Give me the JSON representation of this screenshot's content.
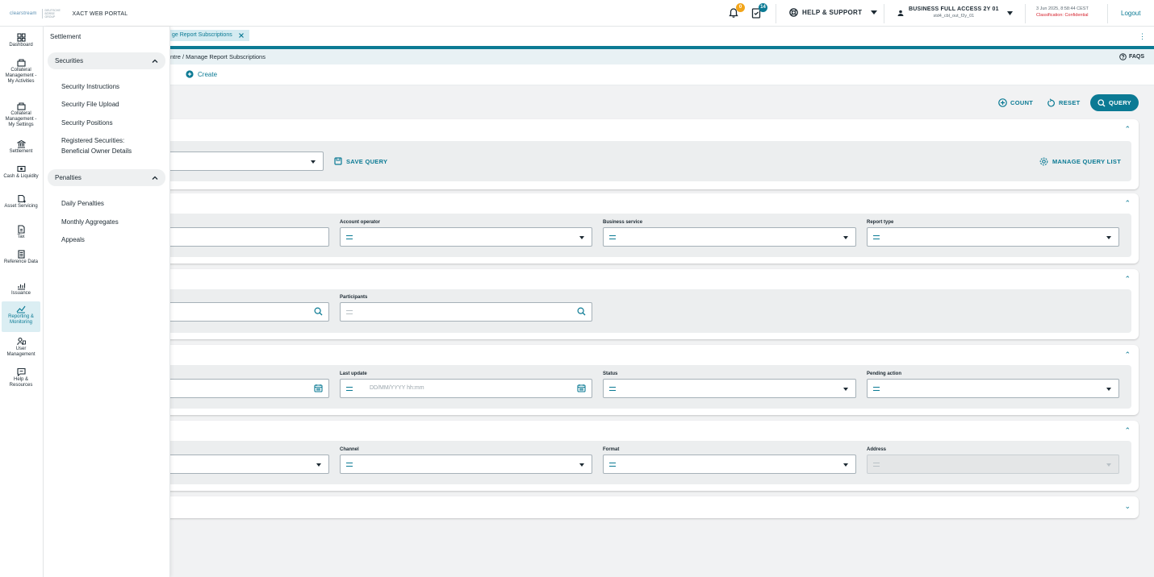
{
  "topbar": {
    "brand_logo": "clearstream",
    "brand_sub": "DEUTSCHE BÖRSE GROUP",
    "portal_name": "XACT WEB PORTAL",
    "notifications_count": "0",
    "tasks_count": "14",
    "help_label": "HELP & SUPPORT",
    "user_name": "BUSINESS FULL ACCESS 2Y 01",
    "user_id": "std4_cbl_out_f2y_01",
    "date": "3 Jun 2025, 8:58:44 CEST",
    "classification": "Classification: Confidential",
    "logout_label": "Logout"
  },
  "iconnav": {
    "items": [
      {
        "label": "Dashboard",
        "icon": "dashboard-icon"
      },
      {
        "label": "Collateral Management - My Activities",
        "icon": "collateral-icon"
      },
      {
        "label": "Collateral Management - My Settings",
        "icon": "collateral-settings-icon"
      },
      {
        "label": "Settlement",
        "icon": "bank-icon"
      },
      {
        "label": "Cash & Liquidity",
        "icon": "cash-icon"
      },
      {
        "label": "Asset Servicing",
        "icon": "asset-icon"
      },
      {
        "label": "Tax",
        "icon": "tax-icon"
      },
      {
        "label": "Reference Data",
        "icon": "reference-icon"
      },
      {
        "label": "Issuance",
        "icon": "issuance-icon"
      },
      {
        "label": "Reporting & Monitoring",
        "icon": "reporting-icon"
      },
      {
        "label": "User Management",
        "icon": "user-management-icon"
      },
      {
        "label": "Help & Resources",
        "icon": "help-icon"
      }
    ]
  },
  "flyout": {
    "title": "Settlement",
    "groups": [
      {
        "label": "Securities",
        "items": [
          "Security Instructions",
          "Security File Upload",
          "Security Positions",
          "Registered Securities: Beneficial Owner Details"
        ]
      },
      {
        "label": "Penalties",
        "items": [
          "Daily Penalties",
          "Monthly Aggregates",
          "Appeals"
        ]
      }
    ]
  },
  "tab": {
    "label": "ge Report Subscriptions"
  },
  "breadcrumb": "ntre  /  Manage Report Subscriptions",
  "faqs_label": "FAQS",
  "create_label": "Create",
  "actions": {
    "count": "COUNT",
    "reset": "RESET",
    "query": "QUERY"
  },
  "query_card": {
    "save_query": "SAVE QUERY",
    "manage_query_list": "MANAGE QUERY LIST"
  },
  "section2": {
    "labels": [
      "Account operator",
      "Business service",
      "Report type"
    ]
  },
  "section3": {
    "labels": [
      "Participants"
    ]
  },
  "section4": {
    "labels": [
      "Last update",
      "Status",
      "Pending action"
    ],
    "date_placeholder": "DD/MM/YYYY hh:mm"
  },
  "section5": {
    "labels": [
      "Channel",
      "Format",
      "Address"
    ]
  }
}
